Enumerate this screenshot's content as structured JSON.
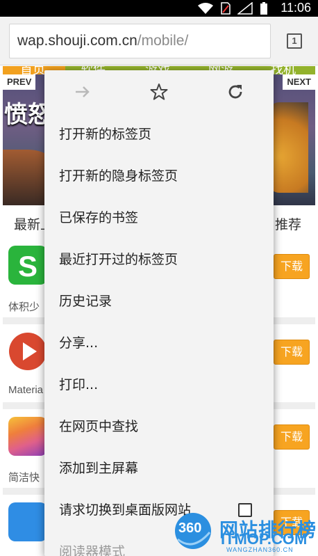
{
  "status_bar": {
    "time": "11:06",
    "icons": [
      "wifi-icon",
      "no-sim-icon",
      "signal-icon",
      "battery-icon"
    ]
  },
  "toolbar": {
    "url_host": "wap.shouji.com.cn",
    "url_path": "/mobile/",
    "tab_count": "1"
  },
  "page": {
    "nav_items": [
      "首页",
      "软件",
      "游戏",
      "网游",
      "找机"
    ],
    "slider": {
      "title": "愤怒",
      "prev_label": "PREV",
      "next_label": "NEXT"
    },
    "section_left": "最新上",
    "section_right": "推荐",
    "apps": [
      {
        "icon": "s-app-icon",
        "color": "#2ab43c",
        "desc": "体积少",
        "download": "下载"
      },
      {
        "icon": "play-app-icon",
        "color": "#d9482f",
        "desc": "Materia",
        "download": "下载"
      },
      {
        "icon": "stripes-app-icon",
        "color": "#e0608a",
        "desc": "简洁快",
        "download": "下载"
      },
      {
        "icon": "blue-app-icon",
        "color": "#2f8de4",
        "desc": "",
        "download": "下载"
      }
    ]
  },
  "menu": {
    "top_icons": [
      "forward-arrow-icon",
      "star-icon",
      "refresh-icon"
    ],
    "items": [
      "打开新的标签页",
      "打开新的隐身标签页",
      "已保存的书签",
      "最近打开过的标签页",
      "历史记录",
      "分享...",
      "打印...",
      "在网页中查找",
      "添加到主屏幕",
      "请求切换到桌面版网站",
      "阅读器模式"
    ]
  },
  "watermark": {
    "logo_text": "360",
    "name": "网站排行榜",
    "site": "ITMOP.COM",
    "sub": "WANGZHAN360.CN"
  },
  "colors": {
    "accent_orange": "#f7a421",
    "nav_green": "#93b22c",
    "watermark_blue": "#2b8fe0"
  }
}
